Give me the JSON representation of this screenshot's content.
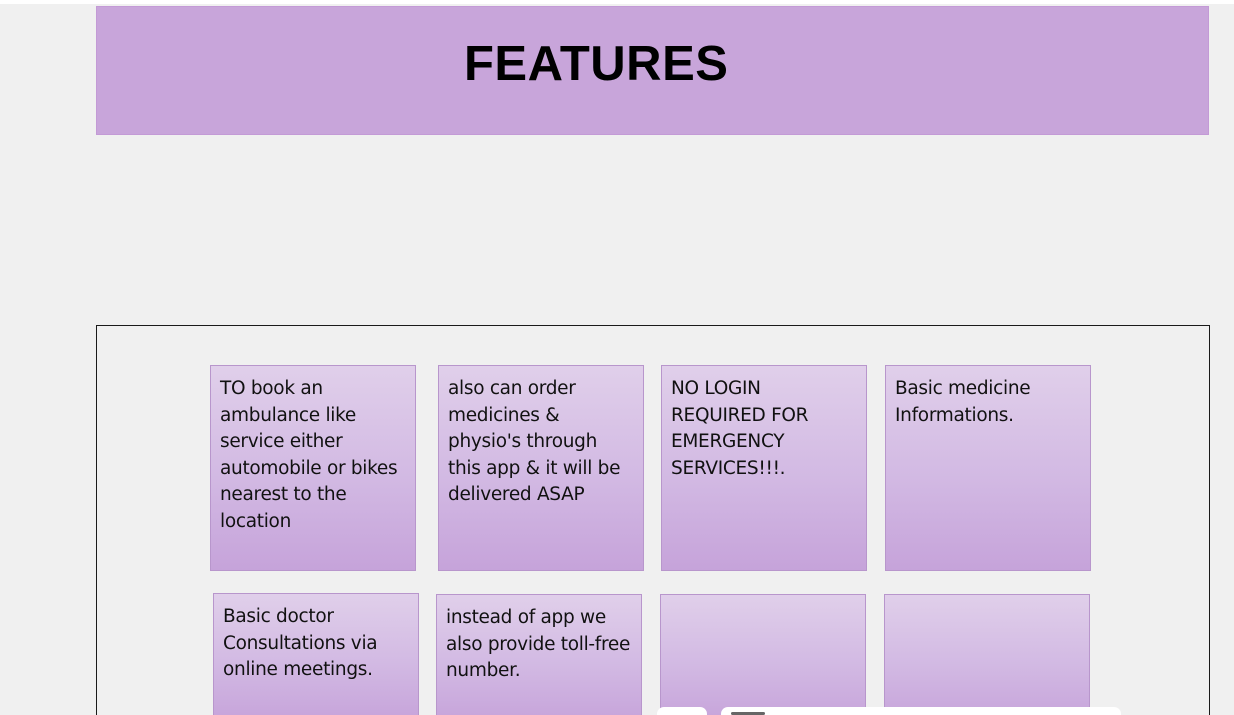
{
  "banner": {
    "title": "FEATURES"
  },
  "cards": [
    {
      "text": "TO book an ambulance like service either automobile or bikes nearest to the location"
    },
    {
      "text": "also can order medicines & physio's through this app & it will be delivered ASAP"
    },
    {
      "text": "NO LOGIN REQUIRED FOR EMERGENCY SERVICES!!!."
    },
    {
      "text": "Basic medicine Informations."
    },
    {
      "text": "Basic doctor Consultations via online meetings."
    },
    {
      "text": "instead of app we also provide toll-free number."
    },
    {
      "text": ""
    },
    {
      "text": ""
    }
  ],
  "colors": {
    "banner_bg": "#c8a5da",
    "card_gradient_top": "#e0cfea",
    "card_gradient_bottom": "#c6a3da",
    "page_bg": "#f0f0f0",
    "frame_border": "#1a1a1a"
  }
}
